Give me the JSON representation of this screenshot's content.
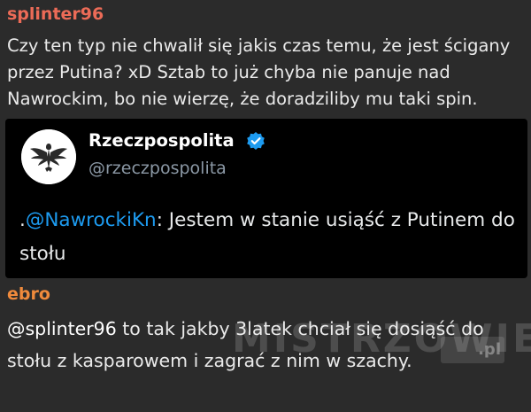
{
  "colors": {
    "background": "#2b2b2b",
    "author_splinter": "#ec6b57",
    "author_ebro": "#ef8a3c",
    "tweet_background": "#000000",
    "mention_blue": "#1d9bf0",
    "verified_badge": "#1d9bf0"
  },
  "comment1": {
    "author": "splinter96",
    "text": "Czy ten typ nie chwalił się jakis czas temu, że jest ścigany\nprzez Putina? xD Sztab to już chyba nie panuje nad\nNawrockim, bo nie wierzę, że doradziliby mu taki spin."
  },
  "tweet": {
    "name": "Rzeczpospolita",
    "handle": "@rzeczpospolita",
    "avatar_icon": "eagle-emblem-icon",
    "verified_icon": "verified-badge-icon",
    "text_prefix": ".",
    "mention": "@NawrockiKn",
    "text_rest": ": Jestem w stanie usiąść z Putinem do stołu"
  },
  "comment2": {
    "author": "ebro",
    "mention": "@splinter96",
    "text_rest": " to tak jakby 3latek chciał się dosiąść do stołu z kasparowem i zagrać z nim w szachy."
  },
  "watermark": {
    "text": "MISTRZOWIE",
    "suffix": ".pl"
  }
}
